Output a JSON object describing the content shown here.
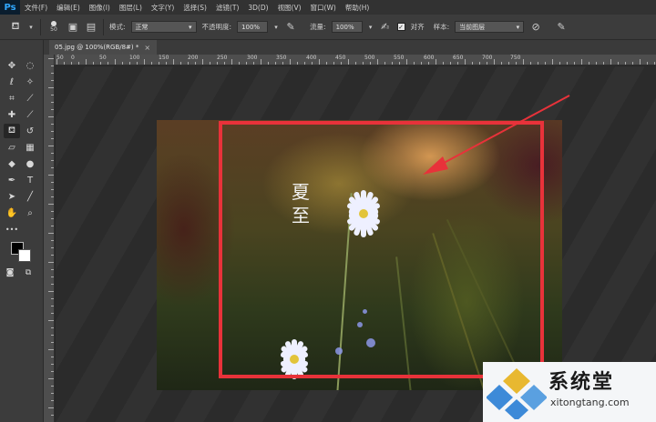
{
  "app": {
    "logo": "Ps"
  },
  "menu": [
    "文件(F)",
    "编辑(E)",
    "图像(I)",
    "图层(L)",
    "文字(Y)",
    "选择(S)",
    "滤镜(T)",
    "3D(D)",
    "视图(V)",
    "窗口(W)",
    "帮助(H)"
  ],
  "options": {
    "brush_size": "50",
    "mode_label": "模式:",
    "mode_value": "正常",
    "opacity_label": "不透明度:",
    "opacity_value": "100%",
    "flow_label": "流量:",
    "flow_value": "100%",
    "aligned_label": "对齐",
    "aligned_checked": true,
    "sample_label": "样本:",
    "sample_value": "当前图层"
  },
  "document": {
    "tab_title": "05.jpg @ 100%(RGB/8#) *",
    "close": "×"
  },
  "ruler": {
    "top_labels": [
      "50",
      "0",
      "50",
      "100",
      "150",
      "200",
      "250",
      "300",
      "350",
      "400",
      "450",
      "500",
      "550",
      "600",
      "650",
      "700",
      "750"
    ],
    "left_labels": [
      "5",
      "0",
      "5",
      "1",
      "0",
      "1",
      "5",
      "2",
      "0"
    ]
  },
  "photo": {
    "title_text": "夏至"
  },
  "annotation": {
    "color": "#e8323a"
  },
  "watermark": {
    "title": "系统堂",
    "url": "xitongtang.com",
    "logo_colors": [
      "#3d8ad8",
      "#e8b830",
      "#5aa0e0"
    ]
  },
  "tools": [
    "move-tool",
    "marquee-tool",
    "lasso-tool",
    "magic-wand-tool",
    "crop-tool",
    "eyedropper-tool",
    "healing-brush-tool",
    "brush-tool",
    "clone-stamp-tool",
    "history-brush-tool",
    "eraser-tool",
    "gradient-tool",
    "blur-tool",
    "dodge-tool",
    "pen-tool",
    "type-tool",
    "path-selection-tool",
    "line-tool",
    "hand-tool",
    "zoom-tool"
  ]
}
